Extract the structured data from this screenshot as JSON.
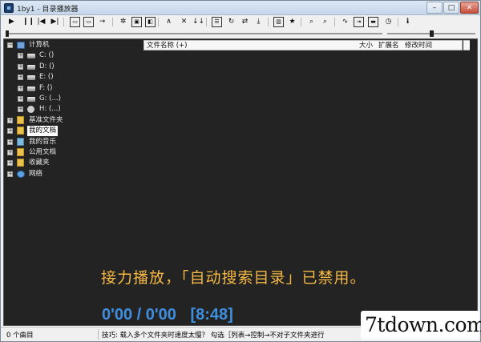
{
  "window": {
    "title": "1by1 - 目录播放器",
    "controls": {
      "minimize": "–",
      "maximize": "□",
      "close": "✕"
    }
  },
  "toolbar": {
    "buttons": [
      {
        "icon": "play-icon",
        "glyph": "▶"
      },
      {
        "icon": "pause-icon",
        "glyph": "❙❙"
      },
      {
        "icon": "previous-icon",
        "glyph": "|◀"
      },
      {
        "icon": "next-icon",
        "glyph": "▶|"
      },
      {
        "icon": "open-folder-icon",
        "glyph": "▭"
      },
      {
        "icon": "prev-folder-icon",
        "glyph": "▭"
      },
      {
        "icon": "jump-icon",
        "glyph": "→"
      },
      {
        "icon": "gear-icon",
        "glyph": "✲"
      },
      {
        "icon": "window-icon",
        "glyph": "▣"
      },
      {
        "icon": "panel-icon",
        "glyph": "◧"
      },
      {
        "icon": "chevron-up-icon",
        "glyph": "∧"
      },
      {
        "icon": "close-icon",
        "glyph": "✕"
      },
      {
        "icon": "sort-icon",
        "glyph": "↓↓"
      },
      {
        "icon": "list-icon",
        "glyph": "☰"
      },
      {
        "icon": "repeat-icon",
        "glyph": "↻"
      },
      {
        "icon": "sync-icon",
        "glyph": "⇄"
      },
      {
        "icon": "download-icon",
        "glyph": "⤓"
      },
      {
        "icon": "library-icon",
        "glyph": "▥"
      },
      {
        "icon": "star-icon",
        "glyph": "★"
      },
      {
        "icon": "search-icon",
        "glyph": "⌕"
      },
      {
        "icon": "search-folder-icon",
        "glyph": "⌕"
      },
      {
        "icon": "wave-icon",
        "glyph": "∿"
      },
      {
        "icon": "skip-icon",
        "glyph": "⇥"
      },
      {
        "icon": "display-icon",
        "glyph": "▬"
      },
      {
        "icon": "clock-icon",
        "glyph": "◷"
      },
      {
        "icon": "info-icon",
        "glyph": "ℹ"
      }
    ]
  },
  "seek": {
    "progress": 0.0,
    "volume": 0.5
  },
  "tree": {
    "items": [
      {
        "label": "计算机",
        "icon": "computer-icon",
        "level": 0,
        "expander": "−"
      },
      {
        "label": "C: ()",
        "icon": "drive-icon",
        "level": 1,
        "expander": "+"
      },
      {
        "label": "D: ()",
        "icon": "drive-icon",
        "level": 1,
        "expander": "+"
      },
      {
        "label": "E: ()",
        "icon": "drive-icon",
        "level": 1,
        "expander": "+"
      },
      {
        "label": "F: ()",
        "icon": "drive-icon",
        "level": 1,
        "expander": "+"
      },
      {
        "label": "G: (...)",
        "icon": "drive-icon",
        "level": 1,
        "expander": "+"
      },
      {
        "label": "H: (...)",
        "icon": "dvd-drive-icon",
        "level": 1,
        "expander": "+"
      },
      {
        "label": "基准文件夹",
        "icon": "folder-icon",
        "level": 0,
        "expander": "+"
      },
      {
        "label": "我的文档",
        "icon": "folder-icon",
        "level": 0,
        "expander": "+",
        "selected": true
      },
      {
        "label": "我的音乐",
        "icon": "music-folder-icon",
        "level": 0,
        "expander": "+"
      },
      {
        "label": "公用文档",
        "icon": "folder-icon",
        "level": 0,
        "expander": "+"
      },
      {
        "label": "收藏夹",
        "icon": "folder-icon",
        "level": 0,
        "expander": "+"
      },
      {
        "label": "网络",
        "icon": "network-icon",
        "level": 0,
        "expander": "+"
      }
    ]
  },
  "filelist": {
    "columns": {
      "name": "文件名称 (+)",
      "size": "大小",
      "ext": "扩展名",
      "modified": "修改时间"
    }
  },
  "player": {
    "message": "接力播放，「自动搜索目录」已禁用。",
    "time": "0'00 / 0'00",
    "total": "[8:48]"
  },
  "status": {
    "count": "0 个曲目",
    "tip": "技巧: 载入多个文件夹时速度太慢？ 勾选［列表→控制→不对子文件夹进行"
  },
  "watermark": "7tdown.com"
}
